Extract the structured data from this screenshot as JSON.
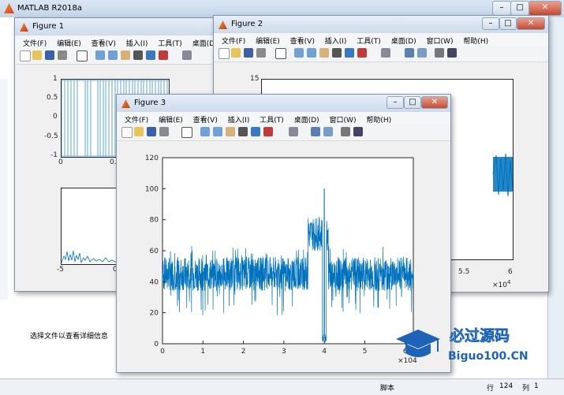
{
  "main": {
    "title": "MATLAB R2018a",
    "detail_text": "选择文件以查看详细信息",
    "status_left": "脚本",
    "status_row_label": "行",
    "status_row": "124",
    "status_col_label": "列",
    "status_col": "1"
  },
  "figures": {
    "fig1": {
      "title": "Figure 1"
    },
    "fig2": {
      "title": "Figure 2"
    },
    "fig3": {
      "title": "Figure 3"
    }
  },
  "menu": {
    "full": [
      "文件(F)",
      "编辑(E)",
      "查看(V)",
      "插入(I)",
      "工具(T)",
      "桌面(D)",
      "窗口(W)",
      "帮助(H)"
    ],
    "short": [
      "文件(F)",
      "编辑(E)",
      "查看(V)",
      "插入(I)",
      "工具(T)",
      "桌面(D)"
    ]
  },
  "fig1_ticks": {
    "top_y": [
      "1",
      "0.5",
      "0",
      "-0.5",
      "-1"
    ],
    "top_x": [
      "0",
      "0.5"
    ],
    "bottom_x": [
      "-5",
      "0"
    ]
  },
  "fig2_ticks": {
    "y_top": "15",
    "x": [
      "5.5",
      "6"
    ],
    "exp_base": "×10",
    "exp_power": "4"
  },
  "chart_data": {
    "type": "line",
    "title": "",
    "xlabel": "",
    "ylabel": "",
    "xlim": [
      0,
      62000
    ],
    "ylim": [
      0,
      120
    ],
    "x_tick_labels": [
      "0",
      "1",
      "2",
      "3",
      "4",
      "5",
      "6"
    ],
    "y_tick_labels": [
      "0",
      "20",
      "40",
      "60",
      "80",
      "100",
      "120"
    ],
    "x_exponent": "×10^4",
    "color": "#0072bd",
    "description_series": [
      {
        "name": "",
        "baseline_mean": 45,
        "noise_range": [
          15,
          60
        ],
        "peak_x": 40000,
        "peak_value": 100,
        "peak_band": [
          36000,
          41000
        ],
        "notch_x": [
          39500,
          40500
        ]
      }
    ]
  },
  "watermark": {
    "line1": "必过源码",
    "line2": "Biguo100.CN"
  }
}
